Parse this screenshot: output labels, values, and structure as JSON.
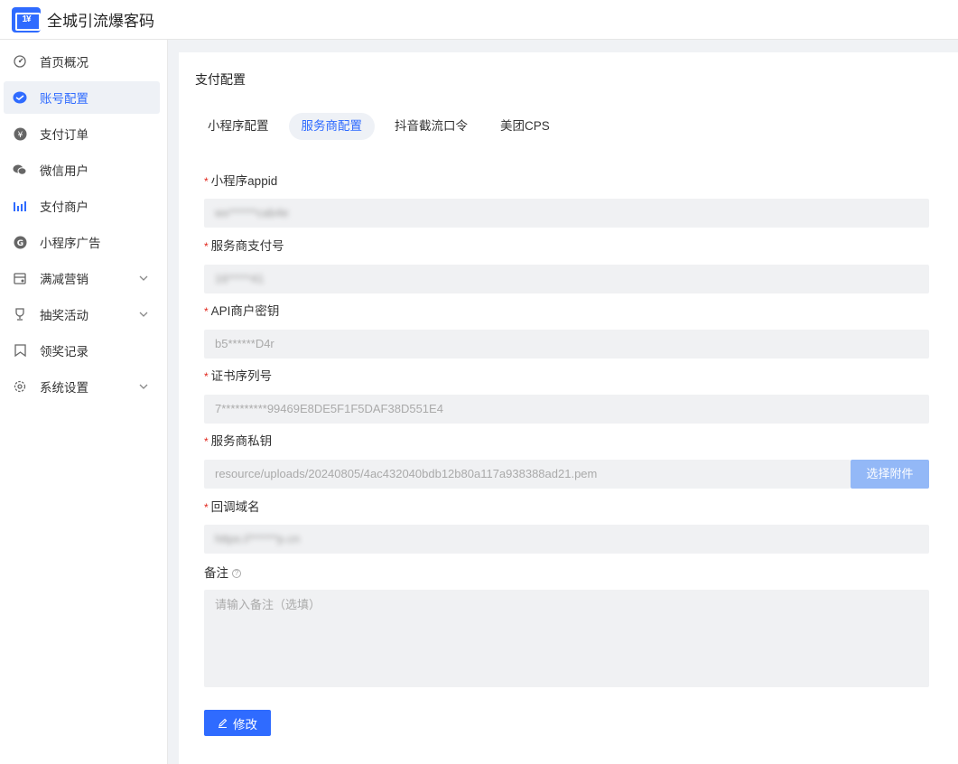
{
  "app": {
    "title": "全城引流爆客码",
    "logo_text": "1¥"
  },
  "sidebar": {
    "items": [
      {
        "label": "首页概况",
        "icon": "dashboard-icon"
      },
      {
        "label": "账号配置",
        "icon": "account-config-icon",
        "active": true
      },
      {
        "label": "支付订单",
        "icon": "payment-order-icon"
      },
      {
        "label": "微信用户",
        "icon": "wechat-icon"
      },
      {
        "label": "支付商户",
        "icon": "bar-chart-icon"
      },
      {
        "label": "小程序广告",
        "icon": "ad-icon"
      },
      {
        "label": "满减营销",
        "icon": "calendar-icon",
        "expandable": true
      },
      {
        "label": "抽奖活动",
        "icon": "trophy-icon",
        "expandable": true
      },
      {
        "label": "领奖记录",
        "icon": "bookmark-icon"
      },
      {
        "label": "系统设置",
        "icon": "gear-icon",
        "expandable": true
      }
    ]
  },
  "main": {
    "section_title": "支付配置",
    "tabs": [
      {
        "label": "小程序配置"
      },
      {
        "label": "服务商配置",
        "active": true
      },
      {
        "label": "抖音截流口令"
      },
      {
        "label": "美团CPS"
      }
    ],
    "form": {
      "appid_label": "小程序appid",
      "appid_value": "wx******cab4e",
      "merchant_no_label": "服务商支付号",
      "merchant_no_value": "16*****41",
      "api_key_label": "API商户密钥",
      "api_key_value": "b5******D4r",
      "cert_serial_label": "证书序列号",
      "cert_serial_value": "7**********99469E8DE5F1F5DAF38D551E4",
      "private_key_label": "服务商私钥",
      "private_key_value": "resource/uploads/20240805/4ac432040bdb12b80a117a938388ad21.pem",
      "pick_file_label": "选择附件",
      "callback_label": "回调域名",
      "callback_value": "https://******p.cn",
      "remark_label": "备注",
      "remark_placeholder": "请输入备注（选填）",
      "submit_label": "修改"
    }
  },
  "colors": {
    "accent": "#2f6bff",
    "required": "#e1251b",
    "field_bg": "#f0f1f3",
    "pick_btn": "#93b8f7"
  }
}
